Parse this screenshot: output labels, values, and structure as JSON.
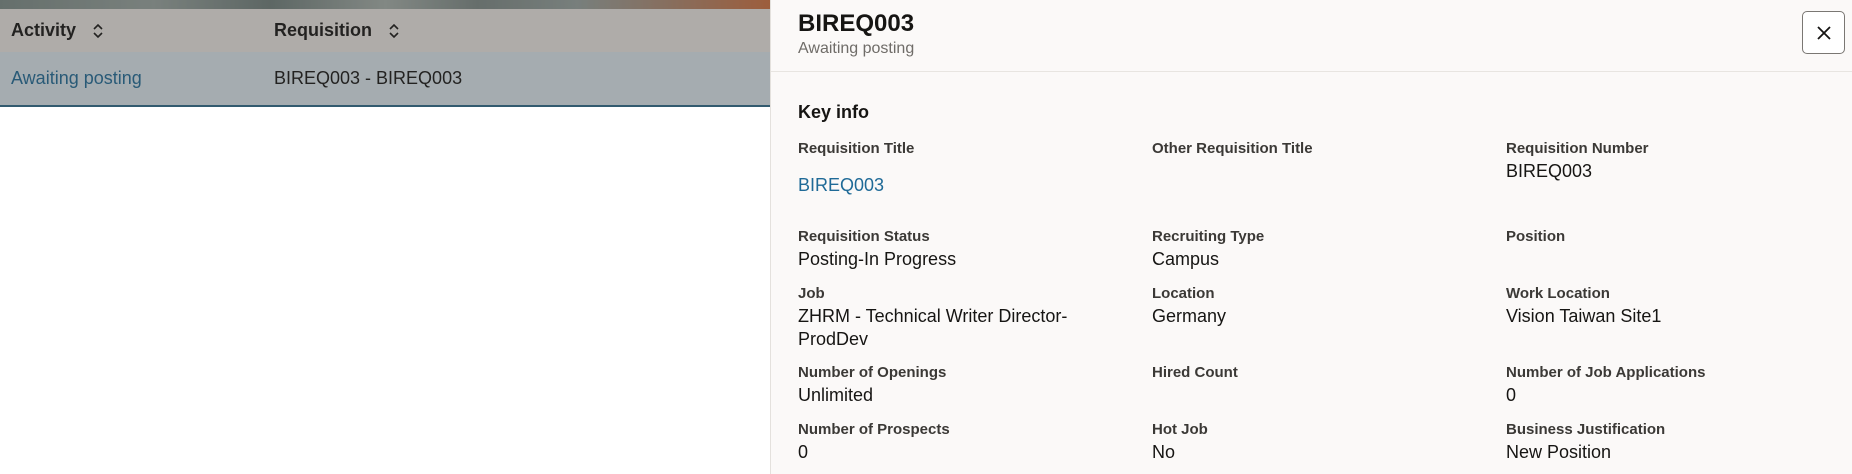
{
  "table": {
    "columns": [
      {
        "label": "Activity"
      },
      {
        "label": "Requisition"
      }
    ],
    "rows": [
      {
        "activity": "Awaiting posting",
        "requisition": "BIREQ003 - BIREQ003"
      }
    ]
  },
  "drawer": {
    "title": "BIREQ003",
    "subtitle": "Awaiting posting",
    "section_title": "Key info",
    "fields": {
      "requisition_title": {
        "label": "Requisition Title",
        "value": "BIREQ003"
      },
      "other_requisition_title": {
        "label": "Other Requisition Title",
        "value": ""
      },
      "requisition_number": {
        "label": "Requisition Number",
        "value": "BIREQ003"
      },
      "requisition_status": {
        "label": "Requisition Status",
        "value": "Posting-In Progress"
      },
      "recruiting_type": {
        "label": "Recruiting Type",
        "value": "Campus"
      },
      "position": {
        "label": "Position",
        "value": ""
      },
      "job": {
        "label": "Job",
        "value": "ZHRM - Technical Writer Director-ProdDev"
      },
      "location": {
        "label": "Location",
        "value": "Germany"
      },
      "work_location": {
        "label": "Work Location",
        "value": "Vision Taiwan Site1"
      },
      "number_of_openings": {
        "label": "Number of Openings",
        "value": "Unlimited"
      },
      "hired_count": {
        "label": "Hired Count",
        "value": ""
      },
      "number_of_job_applications": {
        "label": "Number of Job Applications",
        "value": "0"
      },
      "number_of_prospects": {
        "label": "Number of Prospects",
        "value": "0"
      },
      "hot_job": {
        "label": "Hot Job",
        "value": "No"
      },
      "business_justification": {
        "label": "Business Justification",
        "value": "New Position"
      }
    }
  },
  "icons": {
    "sort": "sort-icon",
    "close": "close-icon"
  },
  "colors": {
    "link": "#1f6a97",
    "selected_row": "#dde9ee",
    "drawer_bg": "#fbf9f8"
  }
}
